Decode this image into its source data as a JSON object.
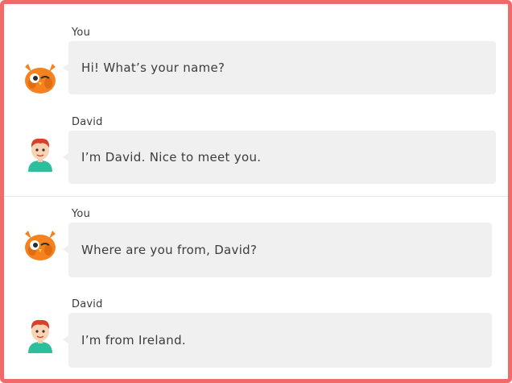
{
  "dialogue": [
    {
      "messages": [
        {
          "speaker": "You",
          "avatar": "owl-mascot-icon",
          "text": "Hi! What’s your name?"
        },
        {
          "speaker": "David",
          "avatar": "boy-avatar-icon",
          "text": "I’m David. Nice to meet you."
        }
      ]
    },
    {
      "messages": [
        {
          "speaker": "You",
          "avatar": "owl-mascot-icon",
          "text": "Where are you from, David?"
        },
        {
          "speaker": "David",
          "avatar": "boy-avatar-icon",
          "text": "I’m from Ireland."
        }
      ]
    }
  ],
  "colors": {
    "frame_border": "#f06a68",
    "bubble_bg": "#f0f0f0",
    "owl_orange": "#f5821f",
    "shirt_teal": "#2dbf9c",
    "hair_red": "#d8402a"
  }
}
